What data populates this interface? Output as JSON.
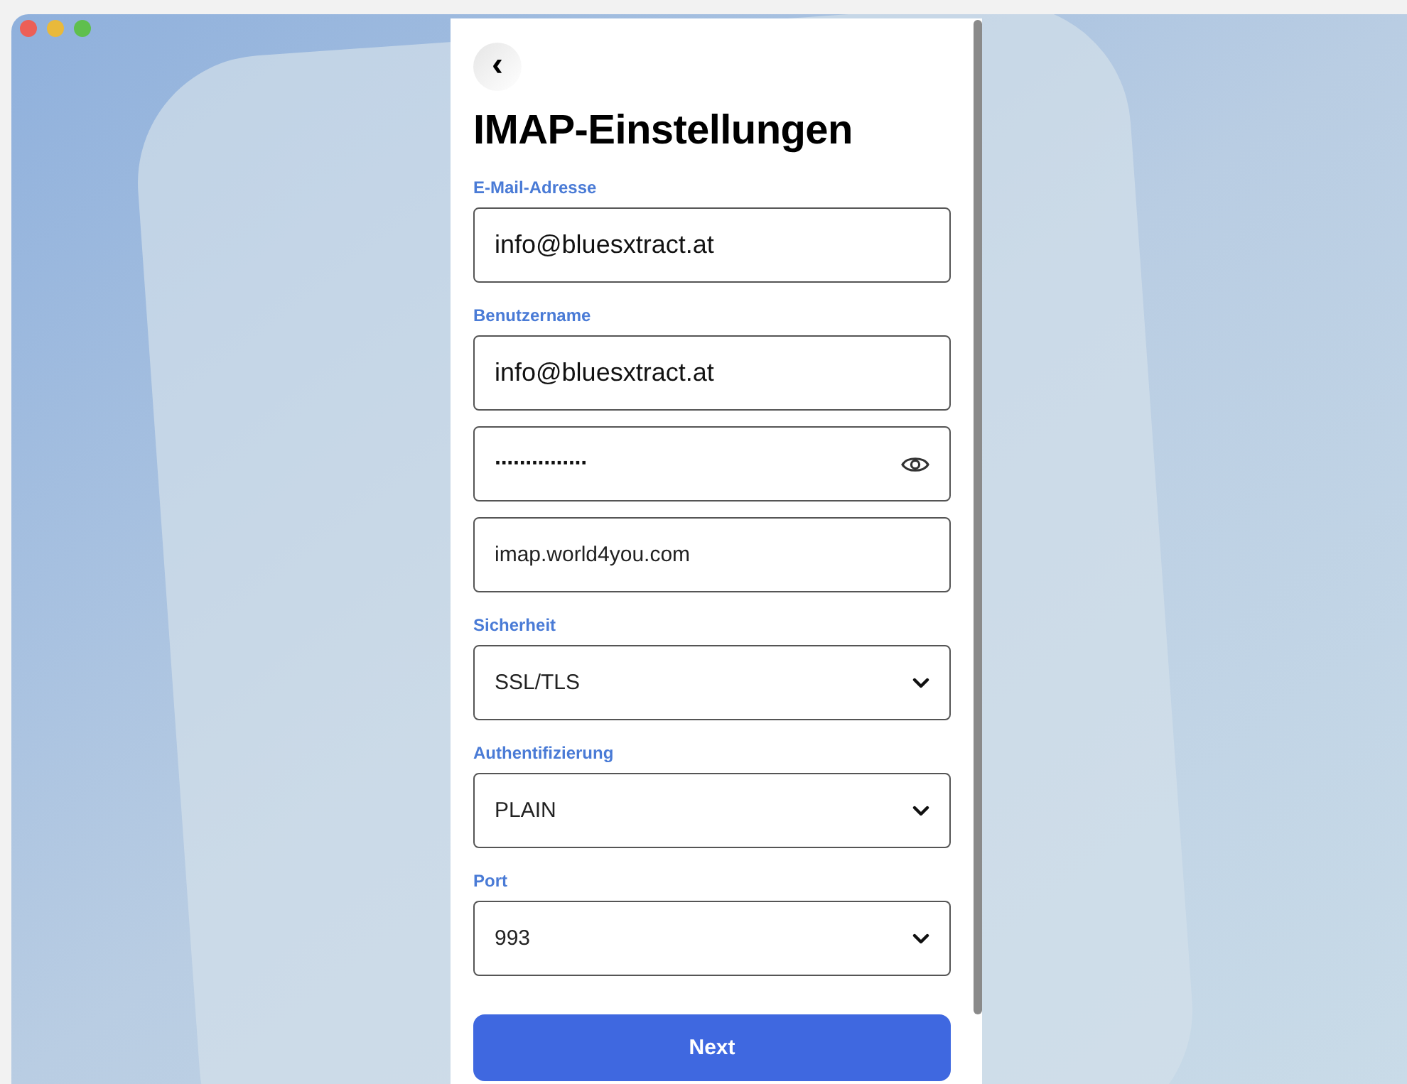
{
  "back_button": {
    "label": "‹"
  },
  "title": "IMAP-Einstellungen",
  "fields": [
    {
      "kind": "text",
      "label": "E-Mail-Adresse",
      "value": "info@bluesxtract.at"
    },
    {
      "kind": "text",
      "label": "Benutzername",
      "value": "info@bluesxtract.at"
    },
    {
      "kind": "password",
      "value": "···············"
    },
    {
      "kind": "text",
      "value": "imap.world4you.com"
    },
    {
      "kind": "select",
      "label": "Sicherheit",
      "value": "SSL/TLS"
    },
    {
      "kind": "select",
      "label": "Authentifizierung",
      "value": "PLAIN"
    },
    {
      "kind": "select",
      "label": "Port",
      "value": "993"
    }
  ],
  "next_button": {
    "label": "Next"
  }
}
